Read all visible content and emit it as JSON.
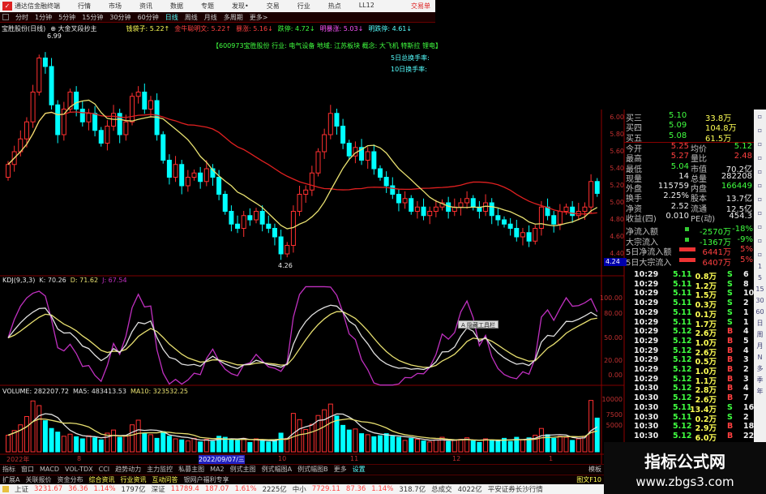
{
  "menubar": {
    "app_title": "通达信金融终端",
    "items": [
      "行情",
      "市场",
      "资讯",
      "数据",
      "专题",
      "发现•",
      "交易",
      "行业",
      "热点",
      "LL12"
    ],
    "trade": "交易单"
  },
  "periods": {
    "items": [
      "分时",
      "1分钟",
      "5分钟",
      "15分钟",
      "30分钟",
      "60分钟",
      "日线",
      "周线",
      "月线",
      "多周期",
      "更多>"
    ],
    "active": "日线"
  },
  "indicator_line": {
    "stock": "宝胜股份(日线)",
    "formula": "⊕ 大金叉段抄主",
    "values": [
      {
        "label": "钱袋子: 5.22↑",
        "color": "yel"
      },
      {
        "label": "金牛聪明文: 5.22↑",
        "color": "red"
      },
      {
        "label": "暴涨: 5.16↓",
        "color": "red"
      },
      {
        "label": "跌停: 4.72↓",
        "color": "grn"
      },
      {
        "label": "明暴涨: 5.03↓",
        "color": "mag"
      },
      {
        "label": "明跌停: 4.61↓",
        "color": "cyan"
      }
    ]
  },
  "stock_info": {
    "line": "【600973宝胜股份 行业: 电气设备 地域: 江苏板块 概念: 大飞机 特斯拉 锂电】",
    "turnover5": "5日总换手率:",
    "turnover10": "10日换手率:"
  },
  "price_marks": {
    "high": "6.99",
    "low": "4.26",
    "cursor": "4.24"
  },
  "chart_data": [
    {
      "type": "candlestick",
      "title": "宝胜股份(日线)",
      "ylim": [
        4.2,
        7.0
      ],
      "price_ticks": [
        "6.00",
        "5.80",
        "5.60",
        "5.40",
        "5.20",
        "5.00",
        "4.80",
        "4.60",
        "4.40"
      ],
      "x_labels": [
        "2022年",
        "8",
        "2022/09/07/三",
        "10",
        "11",
        "12",
        "1"
      ],
      "close": [
        5.45,
        5.6,
        5.75,
        5.95,
        6.3,
        6.7,
        6.6,
        6.15,
        5.8,
        6.1,
        6.3,
        6.1,
        5.95,
        6.05,
        5.85,
        5.7,
        5.9,
        6.05,
        5.8,
        5.95,
        6.25,
        6.3,
        6.1,
        6.2,
        5.8,
        5.5,
        5.3,
        5.45,
        5.2,
        5.3,
        5.35,
        5.25,
        5.4,
        5.3,
        5.1,
        4.9,
        4.75,
        4.7,
        4.85,
        4.8,
        4.9,
        4.75,
        4.7,
        4.6,
        4.4,
        4.5,
        4.9,
        5.1,
        5.15,
        5.35,
        5.6,
        5.8,
        6.05,
        5.9,
        5.7,
        5.55,
        5.65,
        5.5,
        5.6,
        5.4,
        5.3,
        5.2,
        5.1,
        5.0,
        5.05,
        4.9,
        4.95,
        4.85,
        4.9,
        4.95,
        5.0,
        4.9,
        4.95,
        5.0,
        5.05,
        4.95,
        4.9,
        5.0,
        4.85,
        4.8,
        4.75,
        4.7,
        4.6,
        4.65,
        4.55,
        4.7,
        4.95,
        4.85,
        4.75,
        4.9,
        4.95,
        4.85,
        4.9,
        4.95,
        5.25,
        5.11
      ],
      "colors": {
        "up": "#ff3030",
        "down": "#00ffff",
        "ma_long": "#e02020",
        "ma_short": "#e8e070"
      }
    },
    {
      "type": "line",
      "title": "KDJ(9,3,3)",
      "legend": [
        {
          "name": "K: 70.26",
          "color": "#e0e0e0"
        },
        {
          "name": "D: 71.62",
          "color": "#e8e070"
        },
        {
          "name": "J: 67.54",
          "color": "#c030c0"
        }
      ],
      "ylim": [
        0,
        100
      ],
      "ticks": [
        "100.00",
        "80.00",
        "50.00",
        "20.00",
        "0.00"
      ]
    },
    {
      "type": "bar",
      "title": "VOLUME: 282207.72",
      "legend": [
        {
          "name": "MA5: 483413.53",
          "color": "#e0e0e0"
        },
        {
          "name": "MA10: 323532.25",
          "color": "#e8e070"
        }
      ],
      "ticks": [
        "10000",
        "7500",
        "5000"
      ],
      "values": [
        3200,
        4100,
        5200,
        6800,
        9800,
        8900,
        6000,
        4500,
        3800,
        3000,
        3400,
        2900,
        2500,
        3100,
        2700,
        2300,
        3600,
        4200,
        2800,
        3000,
        5200,
        6100,
        3500,
        3300,
        2600,
        3900,
        3000,
        2500,
        2300,
        2100,
        2600,
        1900,
        2400,
        2000,
        3000,
        2800,
        2400,
        2200,
        2600,
        1800,
        2500,
        2100,
        1900,
        2300,
        3600,
        2600,
        7400,
        6200,
        4300,
        5300,
        7000,
        8100,
        9200,
        6900,
        5100,
        4200,
        4400,
        3500,
        3300,
        2900,
        3100,
        3500,
        3000,
        2800,
        2200,
        2600,
        2400,
        2100,
        1900,
        2300,
        2800,
        2000,
        2200,
        2400,
        2700,
        2100,
        1800,
        2500,
        2300,
        2100,
        2600,
        2000,
        2800,
        2300,
        2700,
        3200,
        4500,
        3300,
        2600,
        3000,
        2800,
        2200,
        2500,
        3000,
        9900,
        6500
      ]
    }
  ],
  "quote": {
    "rows": [
      [
        "买三",
        "5.10",
        "33.8万"
      ],
      [
        "买四",
        "5.09",
        "104.8万"
      ],
      [
        "买五",
        "5.08",
        "61.5万"
      ]
    ],
    "stats": [
      [
        "今开",
        "5.25",
        "均价",
        "5.12"
      ],
      [
        "最高",
        "5.27",
        "量比",
        "2.48"
      ],
      [
        "最低",
        "5.04",
        "市值",
        "70.2亿"
      ],
      [
        "现量",
        "14",
        "总量",
        "282208"
      ],
      [
        "外盘",
        "115759",
        "内盘",
        "166449"
      ],
      [
        "换手",
        "2.25%",
        "股本",
        "13.7亿"
      ],
      [
        "净资",
        "2.52",
        "流通",
        "12.5亿"
      ],
      [
        "收益(四)",
        "0.010",
        "PE(动)",
        "454.3"
      ]
    ],
    "flows": [
      [
        "净流入额",
        "-2570万",
        "-18%"
      ],
      [
        "大宗流入",
        "-1367万",
        "-9%"
      ],
      [
        "5日净流入额",
        "6441万",
        "5%"
      ],
      [
        "5日大宗流入",
        "6407万",
        "5%"
      ]
    ]
  },
  "ticks": [
    [
      "10:29",
      "5.11",
      "0.8万",
      "S",
      "6"
    ],
    [
      "10:29",
      "5.11",
      "1.2万",
      "S",
      "8"
    ],
    [
      "10:29",
      "5.11",
      "1.5万",
      "S",
      "10"
    ],
    [
      "10:29",
      "5.11",
      "0.3万",
      "S",
      "2"
    ],
    [
      "10:29",
      "5.11",
      "0.1万",
      "S",
      "1"
    ],
    [
      "10:29",
      "5.11",
      "1.7万",
      "S",
      "1"
    ],
    [
      "10:29",
      "5.12",
      "2.6万",
      "B",
      "4"
    ],
    [
      "10:29",
      "5.12",
      "1.0万",
      "B",
      "5"
    ],
    [
      "10:29",
      "5.12",
      "2.6万",
      "B",
      "4"
    ],
    [
      "10:29",
      "5.12",
      "0.5万",
      "B",
      "3"
    ],
    [
      "10:29",
      "5.12",
      "1.0万",
      "B",
      "2"
    ],
    [
      "10:29",
      "5.12",
      "1.1万",
      "B",
      "3"
    ],
    [
      "10:30",
      "5.12",
      "2.8万",
      "B",
      "4"
    ],
    [
      "10:30",
      "5.12",
      "2.6万",
      "B",
      "7"
    ],
    [
      "10:30",
      "5.11",
      "13.4万",
      "S",
      "16"
    ],
    [
      "10:30",
      "5.11",
      "0.2万",
      "S",
      "2"
    ],
    [
      "10:30",
      "5.12",
      "2.9万",
      "B",
      "18"
    ],
    [
      "10:30",
      "5.12",
      "6.0万",
      "B",
      "22"
    ]
  ],
  "sidebar": [
    "1",
    "5",
    "15",
    "30",
    "60",
    "日",
    "周",
    "月",
    "N",
    "多",
    "季",
    "年"
  ],
  "tabs1": [
    "指标",
    "窗口",
    "MACD",
    "VOL-TDX",
    "CCI",
    "趋势动力",
    "主力监控",
    "私募主图",
    "MA2",
    "例式主图",
    "例式幅图A",
    "例式幅图B",
    "更多",
    "设置"
  ],
  "tabs1_right": "模板",
  "tabs2": [
    "扩展A",
    "关联报价",
    "资金分布",
    "综合资讯",
    "行业资讯",
    "互动问答",
    "银网户福利专享"
  ],
  "tabs2_right": "图文F10",
  "status": {
    "sh": "上证",
    "sh_val": "3231.67",
    "sh_chg": "36.36",
    "sh_pct": "1.14%",
    "sh_amt": "1797亿",
    "sz": "深证",
    "sz_val": "11789.4",
    "sz_chg": "187.07",
    "sz_pct": "1.61%",
    "sz_amt": "2225亿",
    "zx": "中小",
    "zx_val": "7729.11",
    "zx_chg": "87.36",
    "zx_pct": "1.14%",
    "zx_amt": "318.7亿",
    "total": "总成交",
    "total_amt": "4022亿",
    "broker": "平安证券长沙行情"
  },
  "floating_toolbar": "A 隐藏工具栏",
  "watermark": {
    "title": "指标公式网",
    "url": "www.zbgs3.com"
  }
}
